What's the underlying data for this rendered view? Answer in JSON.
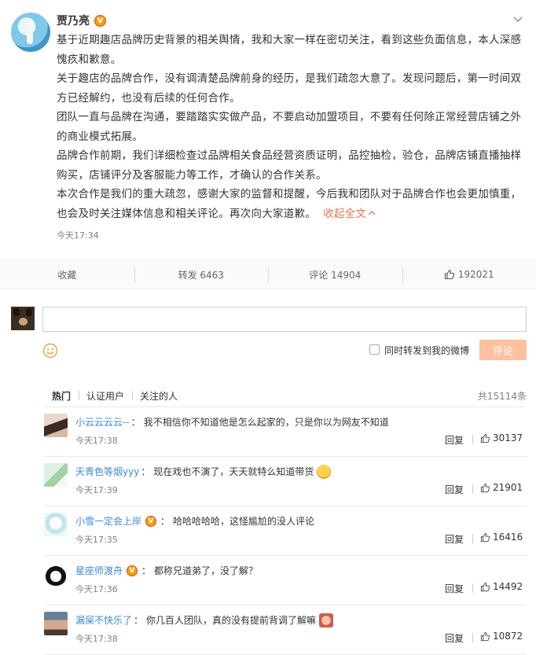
{
  "post": {
    "author": "贾乃亮",
    "verified_badge": "V",
    "paragraphs": [
      "基于近期趣店品牌历史背景的相关舆情，我和大家一样在密切关注，看到这些负面信息，本人深感愧疚和歉意。",
      "关于趣店的品牌合作，没有调清楚品牌前身的经历，是我们疏忽大意了。发现问题后，第一时间双方已经解约，也没有后续的任何合作。",
      "团队一直与品牌在沟通，要踏踏实实做产品，不要启动加盟项目，不要有任何除正常经营店铺之外的商业模式拓展。",
      "品牌合作前期，我们详细检查过品牌相关食品经营资质证明，品控抽检，验仓，品牌店铺直播抽样购买，店铺评分及客服能力等工作，才确认的合作关系。",
      "本次合作是我们的重大疏忽，感谢大家的监督和提醒，今后我和团队对于品牌合作也会更加慎重，也会及时关注媒体信息和相关评论。再次向大家道歉。"
    ],
    "collapse_link": "收起全文",
    "time": "今天17:34"
  },
  "actions": {
    "favorite": "收藏",
    "repost": "转发 6463",
    "comment": "评论 14904",
    "like": "192021"
  },
  "composer": {
    "placeholder": "",
    "forward_label": "同时转发到我的微博",
    "submit_label": "评论"
  },
  "filters": {
    "hot": "热门",
    "verified": "认证用户",
    "following": "关注的人",
    "total": "共15114条"
  },
  "comments": [
    {
      "name": "小云云云云--",
      "text": "我不相信你不知道他是怎么起家的，只是你以为网友不知道",
      "time": "今天17:38",
      "reply": "回复",
      "likes": "30137"
    },
    {
      "name": "天青色等烟yyy",
      "text": "现在戏也不演了，天天就特么知道带货",
      "time": "今天17:39",
      "reply": "回复",
      "likes": "21901"
    },
    {
      "name": "小雪一定会上岸",
      "text": "哈哈哈哈哈，这怪尴尬的没人评论",
      "time": "今天17:35",
      "reply": "回复",
      "likes": "16416"
    },
    {
      "name": "星座师渡舟",
      "text": "都称兄道弟了，没了解？",
      "time": "今天17:36",
      "reply": "回复",
      "likes": "14492"
    },
    {
      "name": "漏屎不快乐了",
      "text": "你几百人团队，真的没有提前背调了解嘛",
      "time": "今天17:38",
      "reply": "回复",
      "likes": "10872"
    }
  ],
  "colors": {
    "link_blue": "#3a8ad9",
    "accent_orange": "#eb7350",
    "submit_disabled": "#ffc09f",
    "badge_gold": "#f6a10b"
  }
}
